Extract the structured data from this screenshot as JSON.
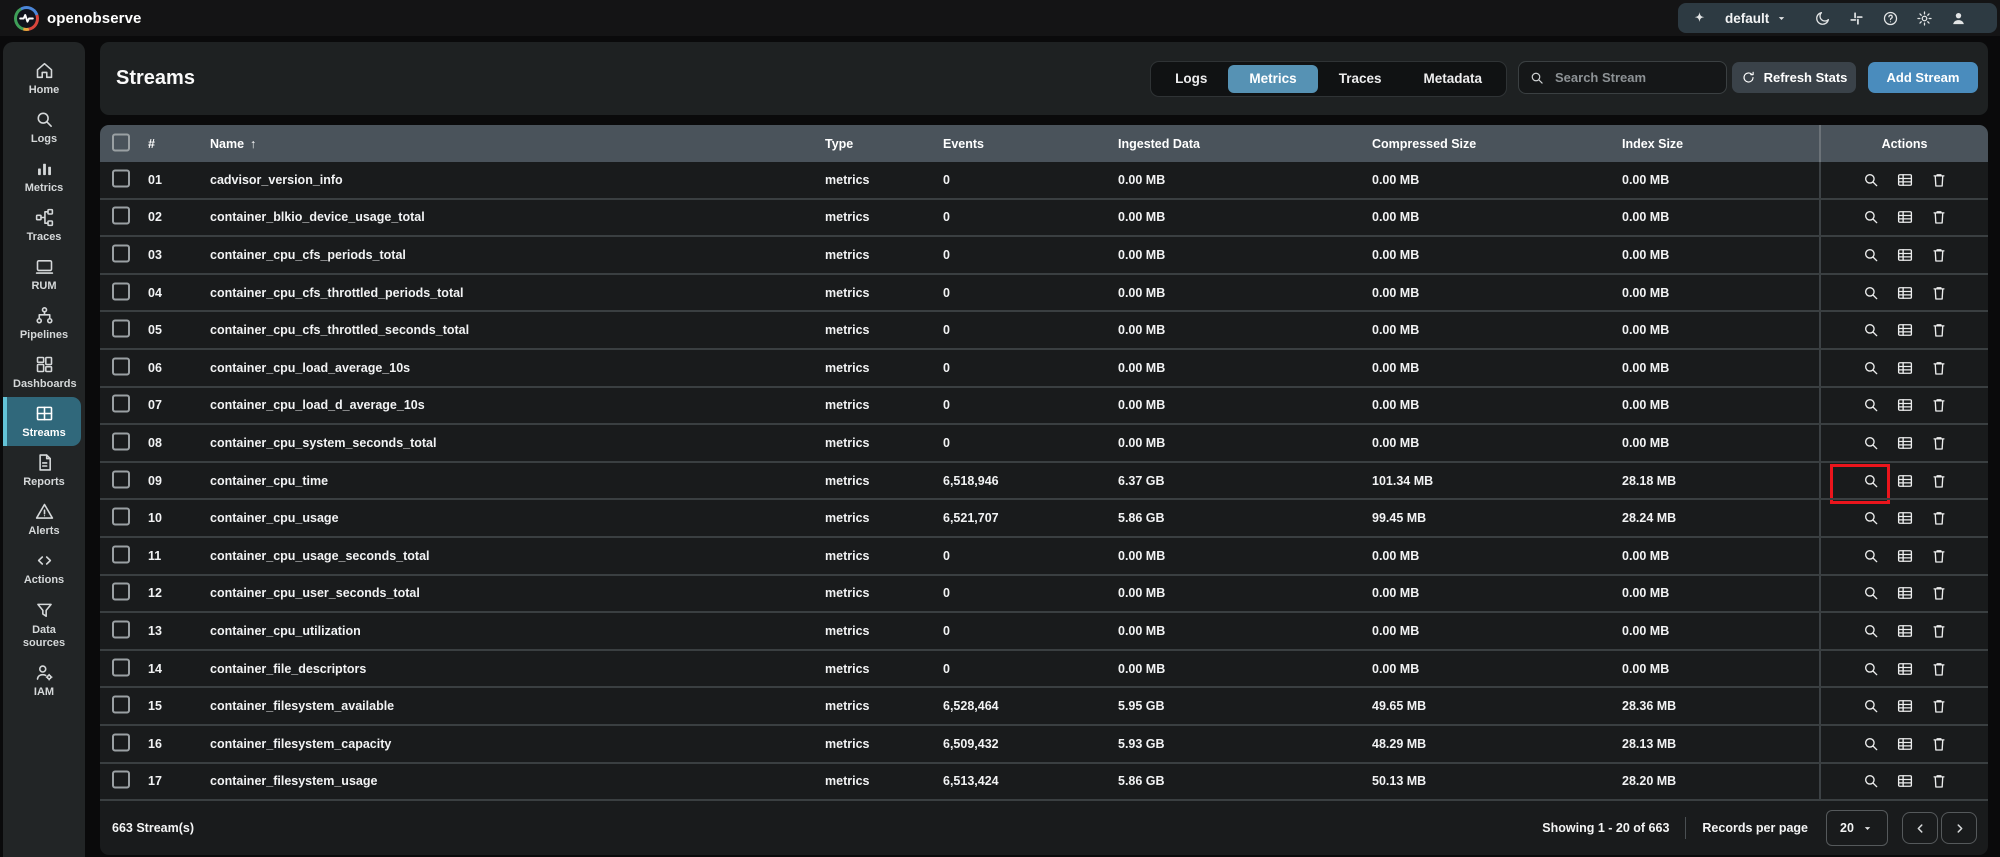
{
  "topbar": {
    "brand": "openobserve",
    "org_selector": "default",
    "icons": [
      "theme-moon-icon",
      "slack-icon",
      "help-icon",
      "settings-gear-icon",
      "user-profile-icon"
    ]
  },
  "sidebar": {
    "items": [
      {
        "label": "Home",
        "icon": "home-icon"
      },
      {
        "label": "Logs",
        "icon": "logs-search-icon"
      },
      {
        "label": "Metrics",
        "icon": "metrics-chart-icon"
      },
      {
        "label": "Traces",
        "icon": "traces-icon"
      },
      {
        "label": "RUM",
        "icon": "rum-monitor-icon"
      },
      {
        "label": "Pipelines",
        "icon": "pipelines-icon"
      },
      {
        "label": "Dashboards",
        "icon": "dashboards-icon"
      },
      {
        "label": "Streams",
        "icon": "streams-grid-icon",
        "active": true
      },
      {
        "label": "Reports",
        "icon": "reports-doc-icon"
      },
      {
        "label": "Alerts",
        "icon": "alerts-warning-icon"
      },
      {
        "label": "Actions",
        "icon": "actions-code-icon"
      },
      {
        "label": "Data sources",
        "icon": "data-sources-filter-icon",
        "tall": true
      },
      {
        "label": "IAM",
        "icon": "iam-user-gear-icon"
      }
    ]
  },
  "header": {
    "title": "Streams",
    "tabs": [
      {
        "label": "Logs"
      },
      {
        "label": "Metrics",
        "active": true
      },
      {
        "label": "Traces"
      },
      {
        "label": "Metadata"
      }
    ],
    "search_placeholder": "Search Stream",
    "refresh_button": "Refresh Stats",
    "add_button": "Add Stream"
  },
  "table": {
    "columns": {
      "num": "#",
      "name": "Name",
      "type": "Type",
      "events": "Events",
      "ingested": "Ingested Data",
      "compressed": "Compressed Size",
      "index": "Index Size",
      "actions": "Actions"
    },
    "sort": {
      "column": "Name",
      "indicator": "↑"
    },
    "action_icons": [
      "search-explore-icon",
      "schema-table-icon",
      "delete-trash-icon"
    ],
    "rows": [
      {
        "num": "01",
        "name": "cadvisor_version_info",
        "type": "metrics",
        "events": "0",
        "ingested": "0.00 MB",
        "compressed": "0.00 MB",
        "index": "0.00 MB"
      },
      {
        "num": "02",
        "name": "container_blkio_device_usage_total",
        "type": "metrics",
        "events": "0",
        "ingested": "0.00 MB",
        "compressed": "0.00 MB",
        "index": "0.00 MB"
      },
      {
        "num": "03",
        "name": "container_cpu_cfs_periods_total",
        "type": "metrics",
        "events": "0",
        "ingested": "0.00 MB",
        "compressed": "0.00 MB",
        "index": "0.00 MB"
      },
      {
        "num": "04",
        "name": "container_cpu_cfs_throttled_periods_total",
        "type": "metrics",
        "events": "0",
        "ingested": "0.00 MB",
        "compressed": "0.00 MB",
        "index": "0.00 MB"
      },
      {
        "num": "05",
        "name": "container_cpu_cfs_throttled_seconds_total",
        "type": "metrics",
        "events": "0",
        "ingested": "0.00 MB",
        "compressed": "0.00 MB",
        "index": "0.00 MB"
      },
      {
        "num": "06",
        "name": "container_cpu_load_average_10s",
        "type": "metrics",
        "events": "0",
        "ingested": "0.00 MB",
        "compressed": "0.00 MB",
        "index": "0.00 MB"
      },
      {
        "num": "07",
        "name": "container_cpu_load_d_average_10s",
        "type": "metrics",
        "events": "0",
        "ingested": "0.00 MB",
        "compressed": "0.00 MB",
        "index": "0.00 MB"
      },
      {
        "num": "08",
        "name": "container_cpu_system_seconds_total",
        "type": "metrics",
        "events": "0",
        "ingested": "0.00 MB",
        "compressed": "0.00 MB",
        "index": "0.00 MB"
      },
      {
        "num": "09",
        "name": "container_cpu_time",
        "type": "metrics",
        "events": "6,518,946",
        "ingested": "6.37 GB",
        "compressed": "101.34 MB",
        "index": "28.18 MB",
        "highlighted": true
      },
      {
        "num": "10",
        "name": "container_cpu_usage",
        "type": "metrics",
        "events": "6,521,707",
        "ingested": "5.86 GB",
        "compressed": "99.45 MB",
        "index": "28.24 MB"
      },
      {
        "num": "11",
        "name": "container_cpu_usage_seconds_total",
        "type": "metrics",
        "events": "0",
        "ingested": "0.00 MB",
        "compressed": "0.00 MB",
        "index": "0.00 MB"
      },
      {
        "num": "12",
        "name": "container_cpu_user_seconds_total",
        "type": "metrics",
        "events": "0",
        "ingested": "0.00 MB",
        "compressed": "0.00 MB",
        "index": "0.00 MB"
      },
      {
        "num": "13",
        "name": "container_cpu_utilization",
        "type": "metrics",
        "events": "0",
        "ingested": "0.00 MB",
        "compressed": "0.00 MB",
        "index": "0.00 MB"
      },
      {
        "num": "14",
        "name": "container_file_descriptors",
        "type": "metrics",
        "events": "0",
        "ingested": "0.00 MB",
        "compressed": "0.00 MB",
        "index": "0.00 MB"
      },
      {
        "num": "15",
        "name": "container_filesystem_available",
        "type": "metrics",
        "events": "6,528,464",
        "ingested": "5.95 GB",
        "compressed": "49.65 MB",
        "index": "28.36 MB"
      },
      {
        "num": "16",
        "name": "container_filesystem_capacity",
        "type": "metrics",
        "events": "6,509,432",
        "ingested": "5.93 GB",
        "compressed": "48.29 MB",
        "index": "28.13 MB"
      },
      {
        "num": "17",
        "name": "container_filesystem_usage",
        "type": "metrics",
        "events": "6,513,424",
        "ingested": "5.86 GB",
        "compressed": "50.13 MB",
        "index": "28.20 MB"
      }
    ]
  },
  "footer": {
    "total": "663 Stream(s)",
    "showing": "Showing 1 - 20 of 663",
    "records_per_page_label": "Records per page",
    "page_size": "20"
  },
  "highlight": {
    "row": "09",
    "target": "search-explore-icon"
  },
  "colors": {
    "accent_tab_blue": "#5692b4",
    "add_button_blue": "#4a8cbd",
    "sidebar_active_bg": "#30687b",
    "sidebar_active_stripe": "#63c3d7",
    "table_header_bg": "#4a535b",
    "highlight_red": "#ea151c"
  }
}
